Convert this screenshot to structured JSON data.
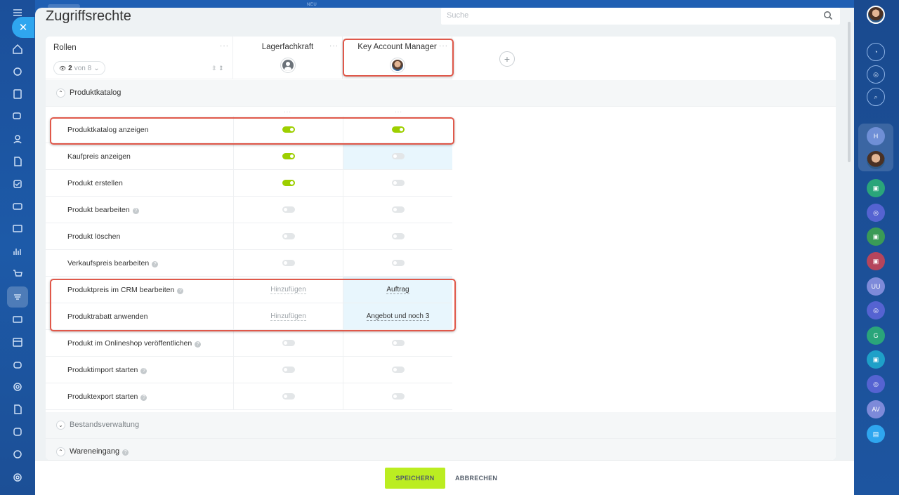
{
  "top_badge": "NEU",
  "page": {
    "title": "Zugriffsrechte",
    "search_placeholder": "Suche"
  },
  "roles": {
    "title": "Rollen",
    "count": "2",
    "of_total": "von 8"
  },
  "columns": [
    {
      "name": "Lagerfachkraft",
      "avatar": "default-user-icon"
    },
    {
      "name": "Key Account Manager",
      "avatar": "user-photo"
    }
  ],
  "sections": {
    "produktkatalog": "Produktkatalog",
    "bestandsverwaltung": "Bestandsverwaltung",
    "wareneingang": "Wareneingang"
  },
  "permissions": [
    {
      "label": "Produktkatalog anzeigen",
      "help": false,
      "c1": "on",
      "c2": "on"
    },
    {
      "label": "Kaufpreis anzeigen",
      "help": false,
      "c1": "on",
      "c2": "off"
    },
    {
      "label": "Produkt erstellen",
      "help": false,
      "c1": "on",
      "c2": "off"
    },
    {
      "label": "Produkt bearbeiten",
      "help": true,
      "c1": "off",
      "c2": "off"
    },
    {
      "label": "Produkt löschen",
      "help": false,
      "c1": "off",
      "c2": "off"
    },
    {
      "label": "Verkaufspreis bearbeiten",
      "help": true,
      "c1": "off",
      "c2": "off"
    },
    {
      "label": "Produktpreis im CRM bearbeiten",
      "help": true,
      "c1": "Hinzufügen",
      "c2": "Auftrag"
    },
    {
      "label": "Produktrabatt anwenden",
      "help": false,
      "c1": "Hinzufügen",
      "c2": "Angebot und noch 3"
    },
    {
      "label": "Produkt im Onlineshop veröffentlichen",
      "help": true,
      "c1": "off",
      "c2": "off"
    },
    {
      "label": "Produktimport starten",
      "help": true,
      "c1": "off",
      "c2": "off"
    },
    {
      "label": "Produktexport starten",
      "help": true,
      "c1": "off",
      "c2": "off"
    }
  ],
  "footer": {
    "save": "SPEICHERN",
    "cancel": "ABBRECHEN"
  },
  "right_rail": {
    "initials": [
      "H",
      "UU",
      "G",
      "AV"
    ]
  },
  "colors": {
    "toggle_on": "#9dcf00",
    "save_button": "#bbed21",
    "highlight_outline": "#e0584a",
    "highlight_cell": "#e8f6fd",
    "sidebar": "#1d5aa8"
  }
}
